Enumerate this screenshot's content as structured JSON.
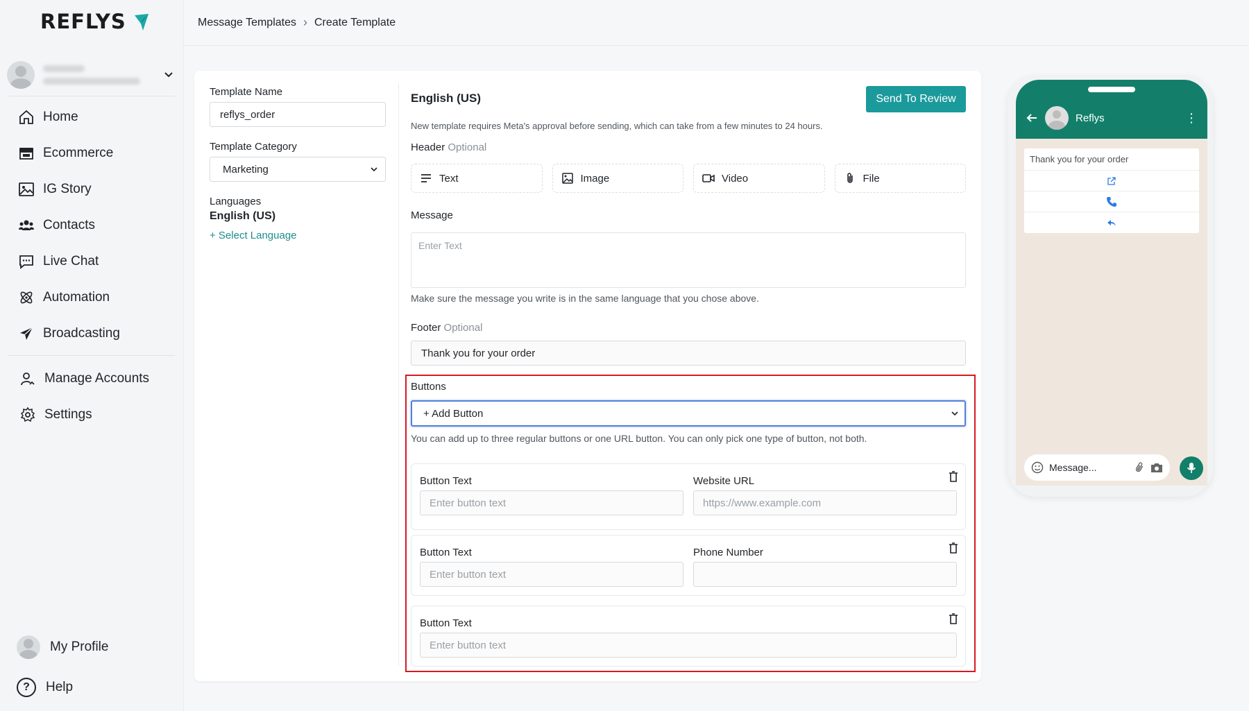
{
  "brand": {
    "name": "REFLYS",
    "accent": "#1b9a9b",
    "red": "#d71921"
  },
  "sidebar": {
    "items": [
      {
        "label": "Home",
        "icon": "home-icon"
      },
      {
        "label": "Ecommerce",
        "icon": "store-icon"
      },
      {
        "label": "IG Story",
        "icon": "image-icon"
      },
      {
        "label": "Contacts",
        "icon": "users-icon"
      },
      {
        "label": "Live Chat",
        "icon": "chat-icon"
      },
      {
        "label": "Automation",
        "icon": "atom-icon"
      },
      {
        "label": "Broadcasting",
        "icon": "send-icon"
      }
    ],
    "items2": [
      {
        "label": "Manage Accounts",
        "icon": "user-manage-icon"
      },
      {
        "label": "Settings",
        "icon": "gear-icon"
      }
    ],
    "profile_label": "My Profile",
    "help_label": "Help"
  },
  "breadcrumb": {
    "parent": "Message Templates",
    "current": "Create Template"
  },
  "form": {
    "template_name_label": "Template Name",
    "template_name_value": "reflys_order",
    "category_label": "Template Category",
    "category_value": "Marketing",
    "languages_label": "Languages",
    "language_value": "English (US)",
    "select_language_link": "+ Select Language"
  },
  "editor": {
    "language_title": "English (US)",
    "send_review_label": "Send To Review",
    "notice": "New template requires Meta's approval before sending, which can take from a few minutes to 24 hours.",
    "header_label": "Header",
    "optional": "Optional",
    "header_options": [
      "Text",
      "Image",
      "Video",
      "File"
    ],
    "message_label": "Message",
    "message_placeholder": "Enter Text",
    "message_help": "Make sure the message you write is in the same language that you chose above.",
    "footer_label": "Footer",
    "footer_value": "Thank you for your order",
    "buttons_label": "Buttons",
    "add_button_label": "+ Add Button",
    "buttons_help": "You can add up to three regular buttons or one URL button. You can only pick one type of button, not both.",
    "button_blocks": [
      {
        "text_label": "Button Text",
        "text_placeholder": "Enter button text",
        "extra_label": "Website URL",
        "extra_placeholder": "https://www.example.com"
      },
      {
        "text_label": "Button Text",
        "text_placeholder": "Enter button text",
        "extra_label": "Phone Number",
        "extra_placeholder": ""
      },
      {
        "text_label": "Button Text",
        "text_placeholder": "Enter button text"
      }
    ]
  },
  "preview": {
    "contact_name": "Reflys",
    "bubble_text": "Thank you for your order",
    "input_placeholder": "Message...",
    "header_color": "#137f6a"
  }
}
